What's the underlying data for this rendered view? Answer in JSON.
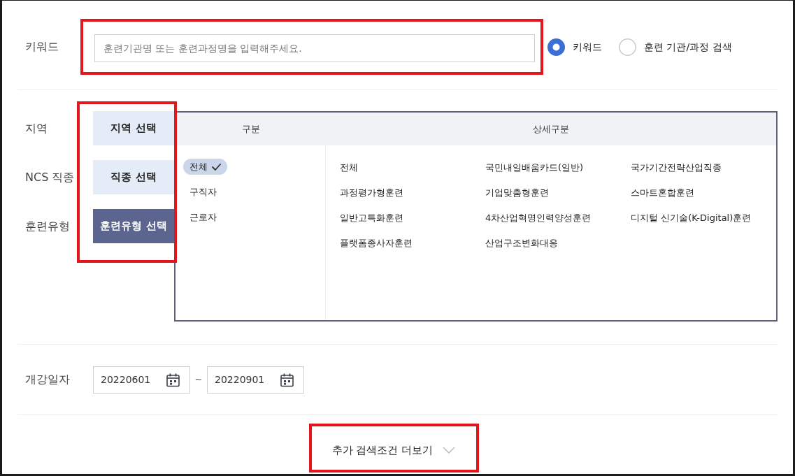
{
  "keyword": {
    "label": "키워드",
    "highlighted": true,
    "input": {
      "placeholder": "훈련기관명 또는 훈련과정명을 입력해주세요."
    },
    "search_modes": [
      {
        "label": "키워드",
        "selected": true
      },
      {
        "label": "훈련 기관/과정 검색",
        "selected": false
      }
    ]
  },
  "filters": {
    "highlighted": true,
    "rows": [
      {
        "label": "지역",
        "tab": "지역 선택",
        "selected": false
      },
      {
        "label": "NCS 직종",
        "tab": "직종 선택",
        "selected": false
      },
      {
        "label": "훈련유형",
        "tab": "훈련유형 선택",
        "selected": true
      }
    ]
  },
  "training_type_panel": {
    "columns": [
      "구분",
      "상세구분"
    ],
    "categories": [
      {
        "label": "전체",
        "selected": true
      },
      {
        "label": "구직자",
        "selected": false
      },
      {
        "label": "근로자",
        "selected": false
      }
    ],
    "details": [
      "전체",
      "국민내일배움카드(일반)",
      "국가기간전략산업직종",
      "과정평가형훈련",
      "기업맞춤형훈련",
      "스마트혼합훈련",
      "일반고특화훈련",
      "4차산업혁명인력양성훈련",
      "디지털 신기술(K-Digital)훈련",
      "플랫폼종사자훈련",
      "산업구조변화대응"
    ]
  },
  "start_date": {
    "label": "개강일자",
    "from": "20220601",
    "separator": "~",
    "to": "20220901"
  },
  "more_button": {
    "label": "추가 검색조건 더보기",
    "highlighted": true
  }
}
